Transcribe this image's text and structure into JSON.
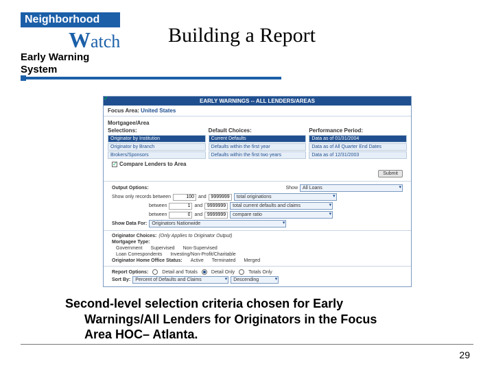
{
  "logo": {
    "top": "Neighborhood",
    "bottom": "atch",
    "bigW": "W"
  },
  "subtitle_line1": "Early Warning",
  "subtitle_line2": "System",
  "title": "Building a Report",
  "panel": {
    "header": "EARLY WARNINGS -- ALL LENDERS/AREAS",
    "focus_label": "Focus Area:",
    "focus_value": "United States",
    "mortgagee_area": "Mortgagee/Area",
    "selections_label": "Selections:",
    "sel_items": [
      "Originator by Institution",
      "Originator by Branch",
      "Brokers/Sponsors"
    ],
    "default_choices_label": "Default Choices:",
    "def_items": [
      "Current Defaults",
      "Defaults within the first year",
      "Defaults within the first two years"
    ],
    "perf_period_label": "Performance Period:",
    "perf_items": [
      "Data as of 01/31/2004",
      "Data as of All Quarter End Dates",
      "Data as of 12/31/2003"
    ],
    "compare_label": "Compare Lenders to Area",
    "submit": "Submit",
    "output_options": "Output Options:",
    "show_label": "Show",
    "show_val": "All Loans",
    "show_only": "Show only records between",
    "between1_a": "100",
    "between1_b": "9999999",
    "total_orig": "total originations",
    "between_label": "between",
    "between2_a": "1",
    "between2_b": "9999999",
    "total_current_def_claims": "total current defaults and claims",
    "between3_a": "0",
    "between3_b": "9999999",
    "compare_ratio": "compare ratio",
    "show_data_for": "Show Data For:",
    "show_data_for_dd": "Originators Nationwide",
    "orig_choices": "Originator Choices:",
    "orig_note": "(Only Applies to Originator Output)",
    "mortgagee_type": "Mortgagee Type:",
    "gov": "Government",
    "sup": "Supervised",
    "nonsup": "Non-Supervised",
    "loancorr": "Loan Correspondents",
    "invnp": "Investing/Non-Profit/Charitable",
    "home_status": "Originator Home Office Status:",
    "active": "Active",
    "terminated": "Terminated",
    "merged": "Merged",
    "report_options": "Report Options:",
    "detail_totals": "Detail and Totals",
    "detail_only": "Detail Only",
    "totals_only": "Totals Only",
    "sort_by": "Sort By:",
    "sort_val": "Percent of Defaults and Claims",
    "sort_dir": "Descending"
  },
  "caption": {
    "line1": "Second-level selection criteria chosen for Early",
    "line2": "Warnings/All Lenders for Originators in the Focus",
    "line3": "Area HOC– Atlanta."
  },
  "page_number": "29"
}
